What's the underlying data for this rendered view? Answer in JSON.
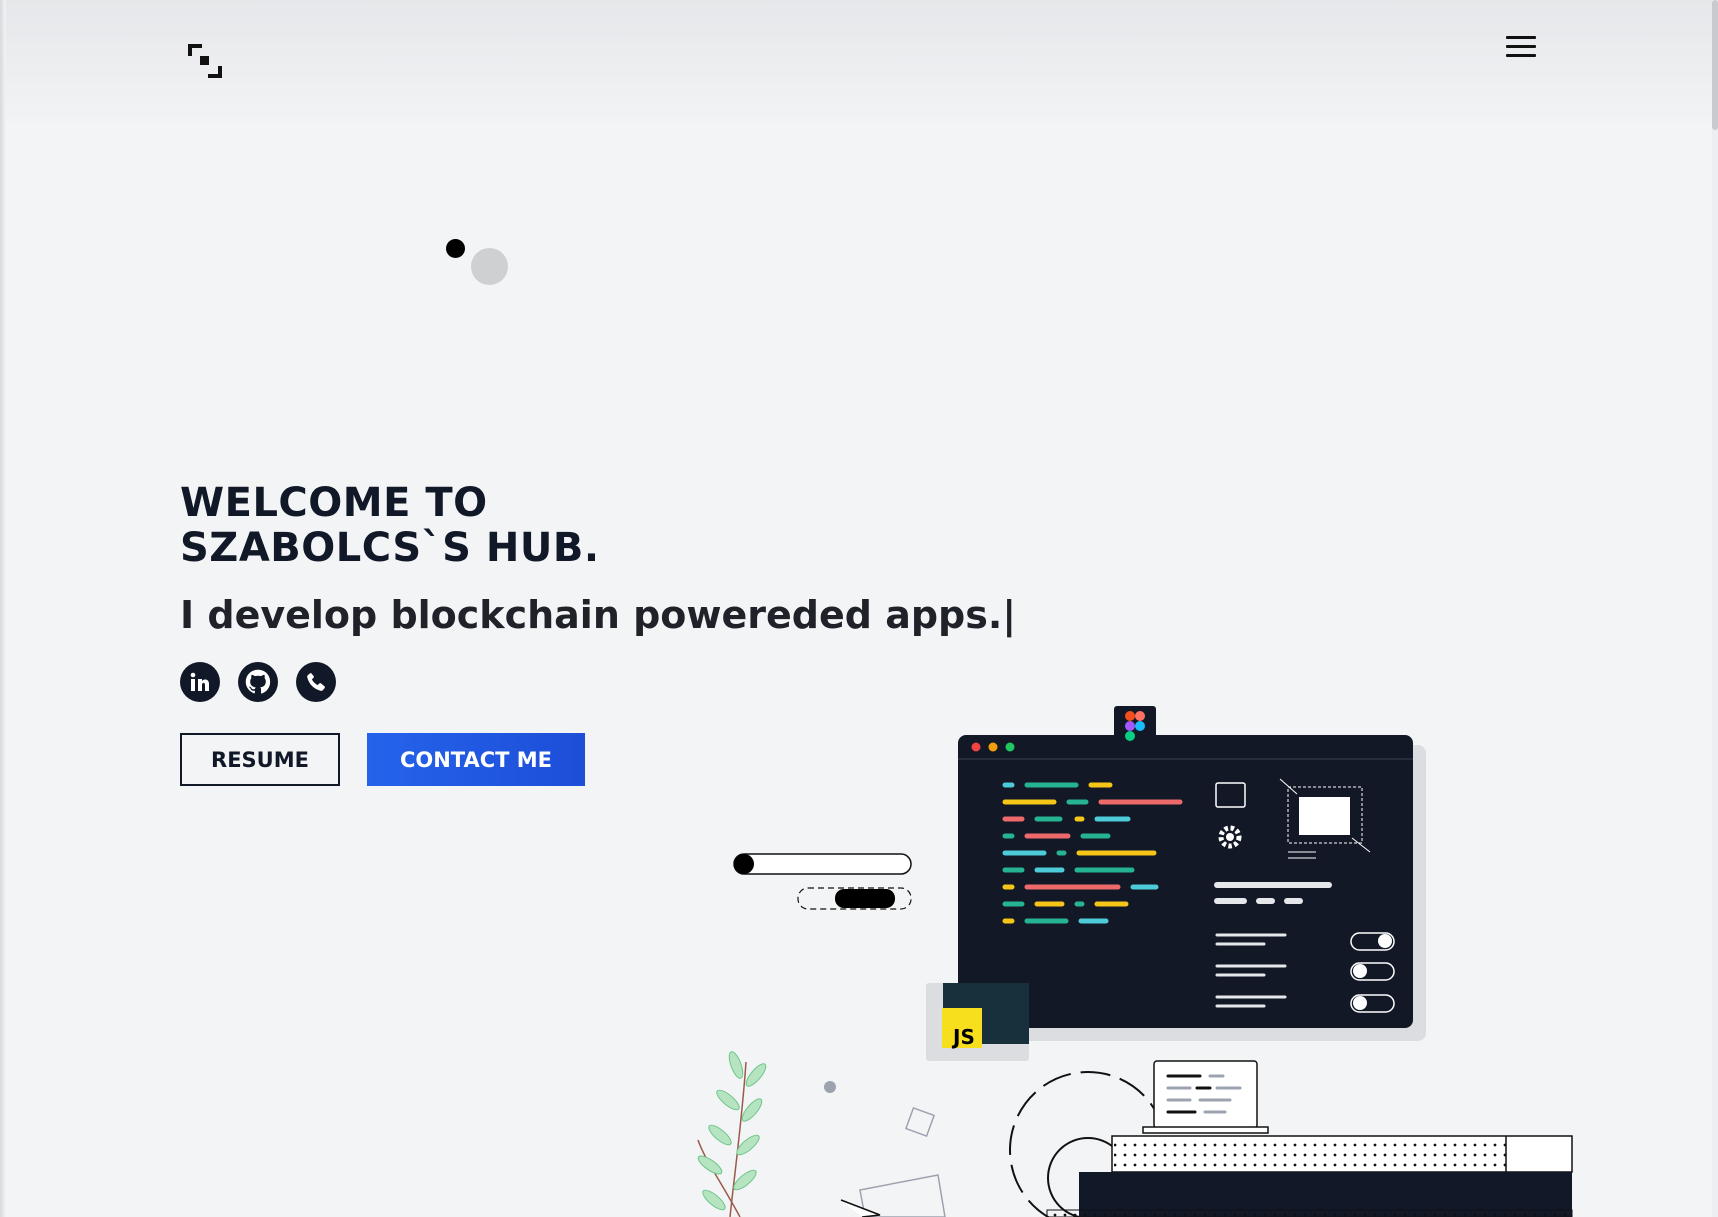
{
  "header": {
    "logo_icon": "logo-icon",
    "menu_icon": "hamburger-menu-icon"
  },
  "hero": {
    "title_line1": "WELCOME TO",
    "title_line2": "SZABOLCS`S HUB.",
    "tagline": "I develop blockchain powereded apps.|"
  },
  "social": [
    {
      "name": "linkedin-icon"
    },
    {
      "name": "github-icon"
    },
    {
      "name": "phone-icon"
    }
  ],
  "buttons": {
    "resume": "RESUME",
    "contact": "CONTACT ME"
  },
  "illustration": {
    "js_badge": "JS"
  },
  "colors": {
    "background": "#f3f4f6",
    "text": "#111827",
    "accent": "#2563eb"
  }
}
